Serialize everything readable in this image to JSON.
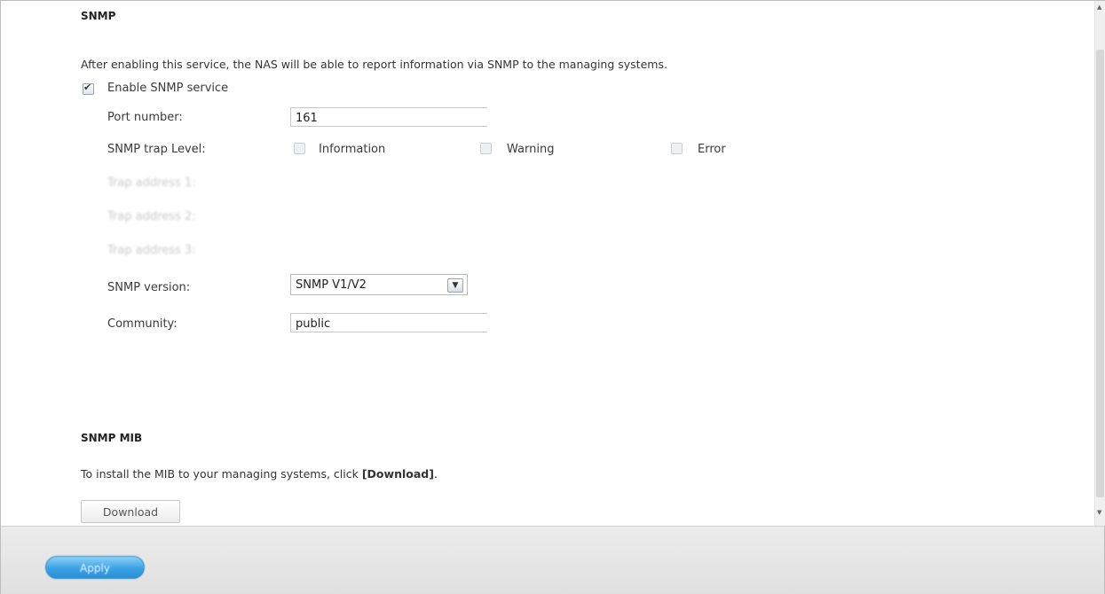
{
  "snmp": {
    "title": "SNMP",
    "description": "After enabling this service, the NAS will be able to report information via SNMP to the managing systems.",
    "enable_label": "Enable SNMP service",
    "enable_checked": true,
    "port_label": "Port number:",
    "port_value": "161",
    "trap_level_label": "SNMP trap Level:",
    "trap_levels": [
      {
        "label": "Information",
        "checked": false
      },
      {
        "label": "Warning",
        "checked": false
      },
      {
        "label": "Error",
        "checked": false
      }
    ],
    "trap_address_1_label": "Trap address 1:",
    "trap_address_2_label": "Trap address 2:",
    "trap_address_3_label": "Trap address 3:",
    "version_label": "SNMP version:",
    "version_value": "SNMP V1/V2",
    "community_label": "Community:",
    "community_value": "public"
  },
  "mib": {
    "title": "SNMP MIB",
    "instruction_prefix": "To install the MIB to your managing systems, click ",
    "instruction_link": "[Download]",
    "instruction_suffix": ".",
    "download_label": "Download"
  },
  "footer": {
    "apply_label": "Apply"
  },
  "icons": {
    "scroll_up": "scroll-up-arrow",
    "scroll_down": "scroll-down-arrow",
    "dropdown": "chevron-down-icon"
  },
  "colors": {
    "apply_button": "#3aa2e6",
    "footer_bg": "#e6e6e6"
  }
}
